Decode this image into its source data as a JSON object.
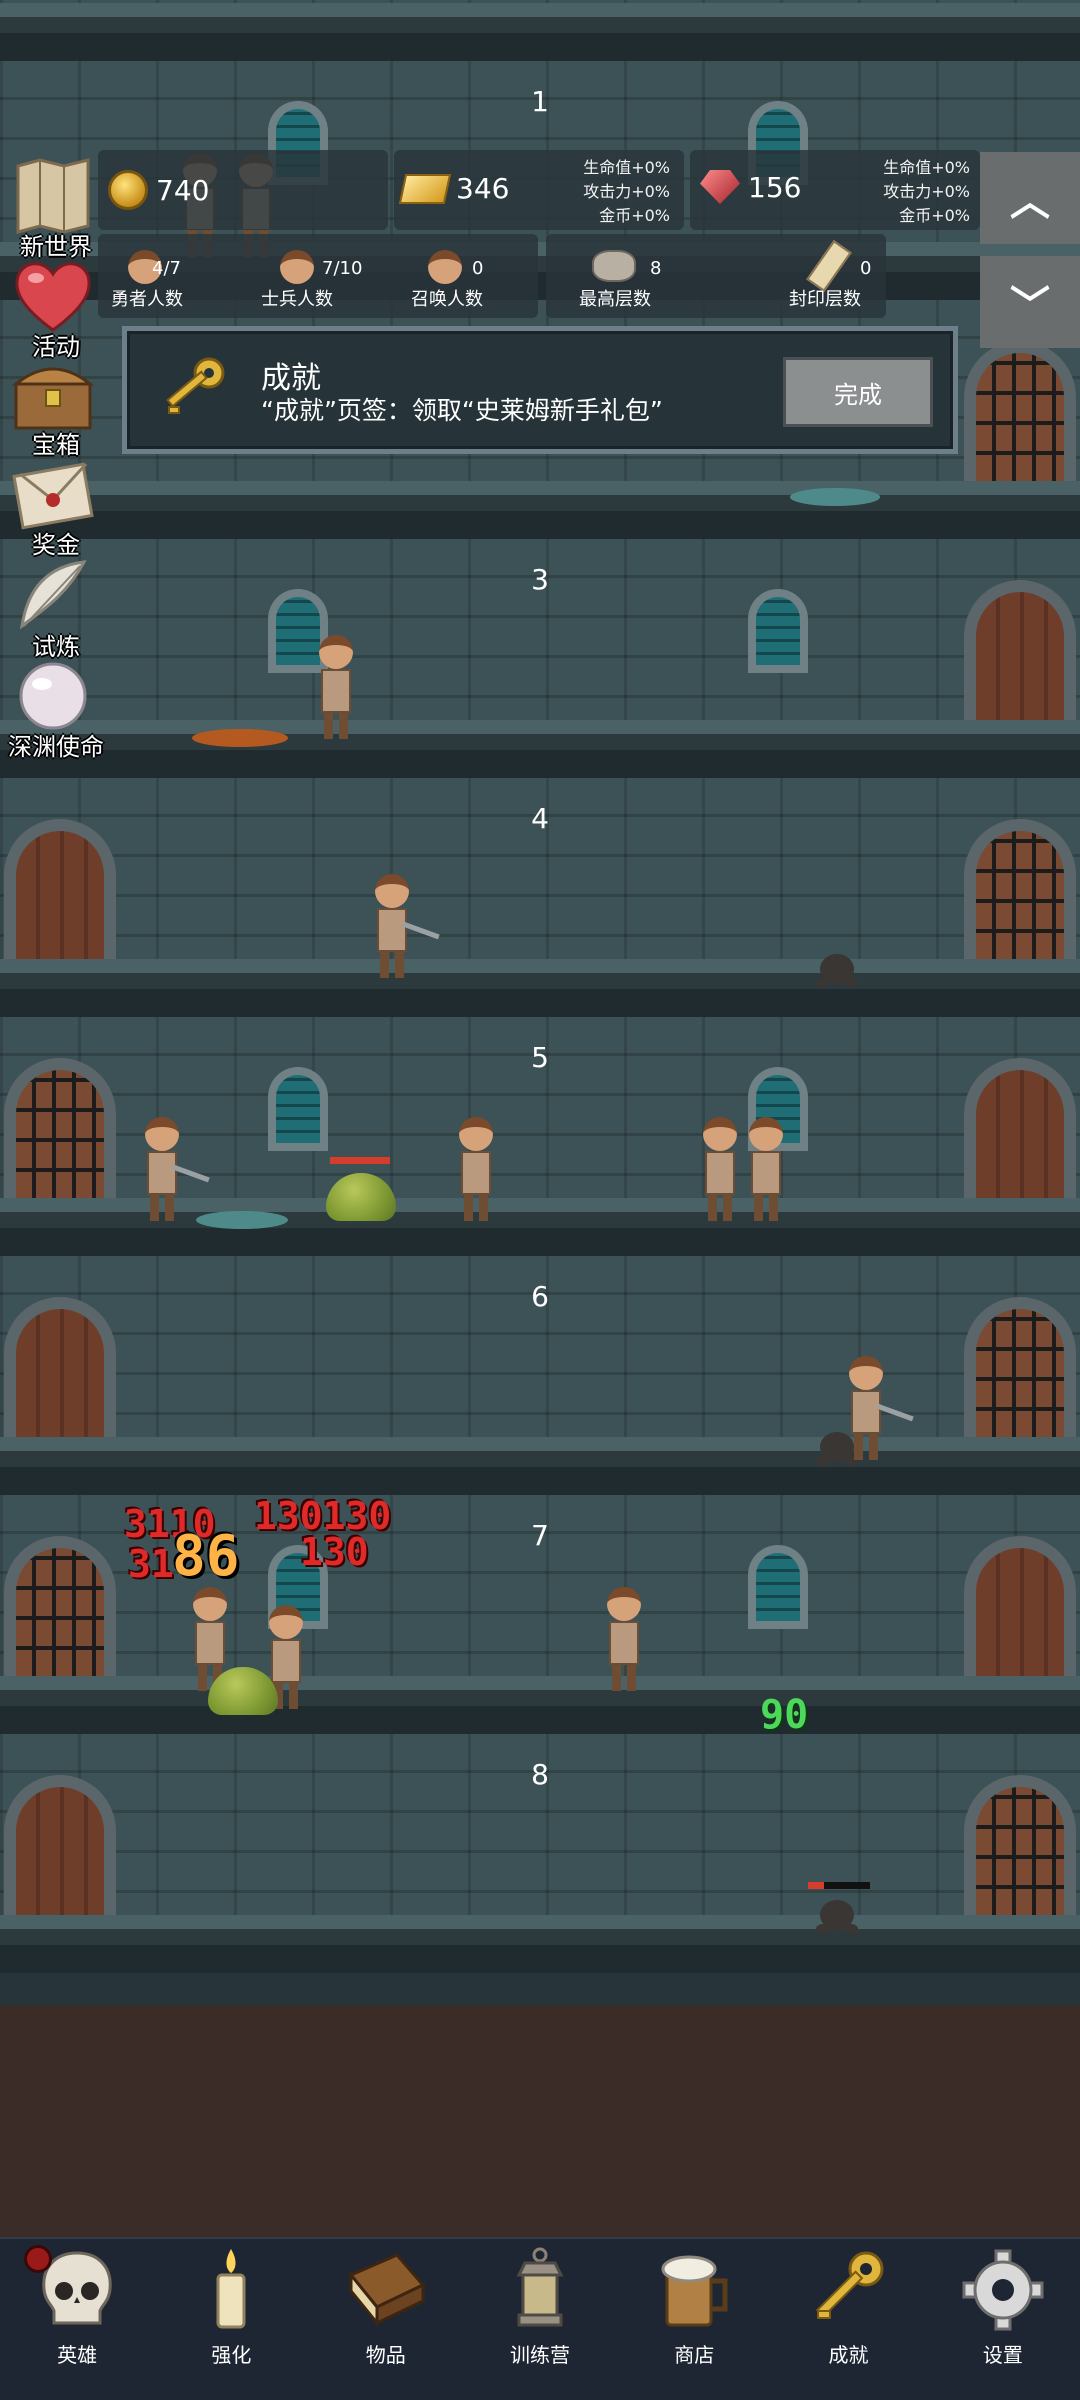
{
  "resources": {
    "coins": "740",
    "gold": "346",
    "gems": "156",
    "gold_bonus": [
      "生命值+0%",
      "攻击力+0%",
      "金币+0%"
    ],
    "gem_bonus": [
      "生命值+0%",
      "攻击力+0%",
      "金币+0%"
    ]
  },
  "counts": [
    {
      "value": "4/7",
      "label": "勇者人数"
    },
    {
      "value": "7/10",
      "label": "士兵人数"
    },
    {
      "value": "0",
      "label": "召唤人数"
    },
    {
      "value": "8",
      "label": "最高层数"
    },
    {
      "value": "0",
      "label": "封印层数"
    }
  ],
  "scroll": {
    "up": "︿",
    "down": "﹀"
  },
  "quest": {
    "title": "成就",
    "description": "“成就”页签：领取“史莱姆新手礼包”",
    "button": "完成"
  },
  "side_menu": [
    {
      "label": "新世界",
      "icon": "map-icon"
    },
    {
      "label": "活动",
      "icon": "heart-icon"
    },
    {
      "label": "宝箱",
      "icon": "chest-icon"
    },
    {
      "label": "奖金",
      "icon": "envelope-icon"
    },
    {
      "label": "试炼",
      "icon": "feather-icon"
    },
    {
      "label": "深渊使命",
      "icon": "pearl-icon"
    }
  ],
  "floors": [
    "1",
    "3",
    "4",
    "5",
    "6",
    "7",
    "8"
  ],
  "damage": {
    "red_a": "3110",
    "red_b": "130130",
    "red_c": "130",
    "red_d": "31",
    "big": "86",
    "heal": "90"
  },
  "bottom_nav": [
    {
      "label": "英雄",
      "icon": "skull-icon"
    },
    {
      "label": "强化",
      "icon": "candle-icon"
    },
    {
      "label": "物品",
      "icon": "book-icon"
    },
    {
      "label": "训练营",
      "icon": "lantern-icon"
    },
    {
      "label": "商店",
      "icon": "beer-mug-icon"
    },
    {
      "label": "成就",
      "icon": "key-icon"
    },
    {
      "label": "设置",
      "icon": "gear-icon"
    }
  ],
  "colors": {
    "nav_bg": "#1f2633",
    "wall": "#3d5256",
    "button": "#8c8f90",
    "damage": "#e02a2a",
    "heal": "#4cd85a"
  }
}
